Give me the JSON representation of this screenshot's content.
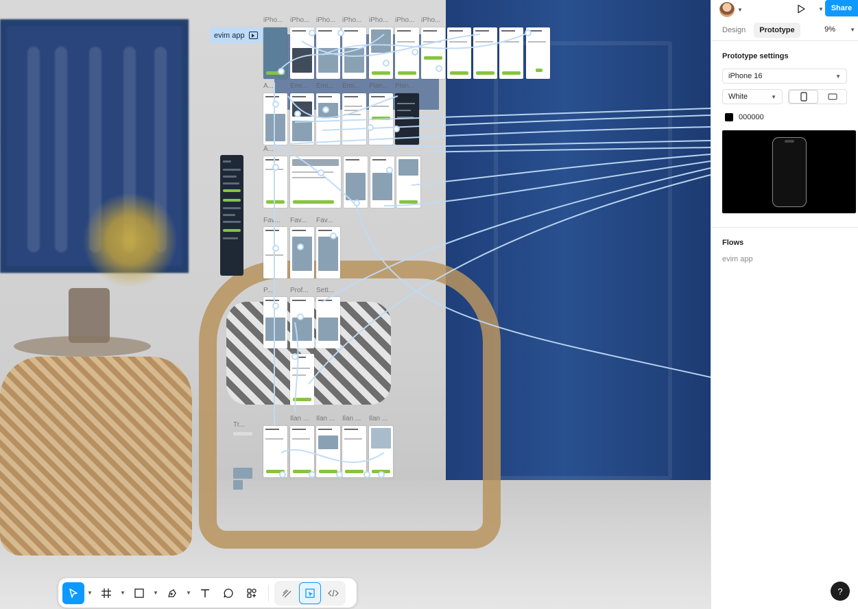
{
  "canvas": {
    "flow_badge_label": "evim app",
    "frame_labels": {
      "row1": [
        "iPho...",
        "iPho...",
        "iPho...",
        "iPho...",
        "iPho...",
        "iPho...",
        "iPho..."
      ],
      "row2": [
        "A...",
        "Emi...",
        "Emi...",
        "Emi...",
        "Plan...",
        "Plan..."
      ],
      "row3": [
        "A...",
        "",
        "",
        "",
        "",
        ""
      ],
      "row4": [
        "Fav...",
        "Fav...",
        "Fav..."
      ],
      "row5": [
        "P...",
        "Prof...",
        "Sett..."
      ],
      "row6": [
        "Tr...",
        "İlan ...",
        "İlan ...",
        "İlan ...",
        "İlan ..."
      ]
    }
  },
  "toolbar": {
    "tools": [
      "move-tool",
      "frame-tool",
      "shape-tool",
      "pen-tool",
      "text-tool",
      "comment-tool",
      "actions-tool"
    ],
    "modes": [
      "draw-mode",
      "design-mode",
      "dev-mode"
    ]
  },
  "right_panel": {
    "share_label": "Share",
    "tabs": [
      "Design",
      "Prototype"
    ],
    "active_tab": "Prototype",
    "zoom": "9%",
    "settings_title": "Prototype settings",
    "device": "iPhone 16",
    "color_model": "White",
    "bg_color": "000000",
    "flows_title": "Flows",
    "flow_item": "evim app",
    "help_label": "?"
  },
  "colors": {
    "accent": "#0d99ff",
    "flow_line": "#bfdbf7",
    "frame_button": "#86c440"
  }
}
